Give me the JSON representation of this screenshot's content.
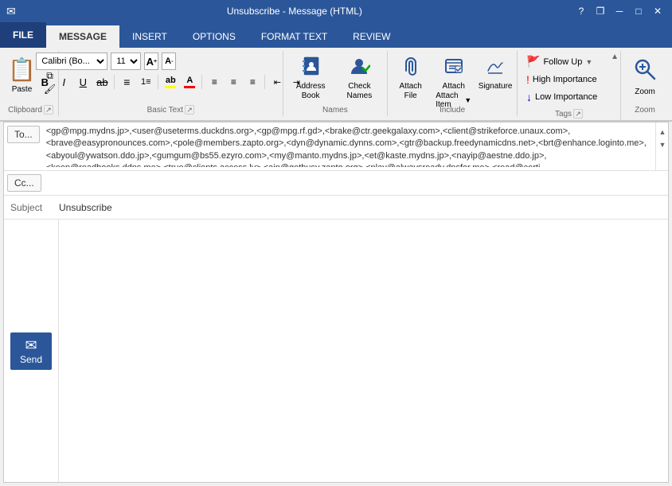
{
  "titleBar": {
    "title": "Unsubscribe - Message (HTML)",
    "helpBtn": "?",
    "restoreBtn": "❐",
    "minimizeBtn": "─",
    "maximizeBtn": "□",
    "closeBtn": "✕"
  },
  "tabs": [
    {
      "id": "file",
      "label": "FILE"
    },
    {
      "id": "message",
      "label": "MESSAGE"
    },
    {
      "id": "insert",
      "label": "INSERT"
    },
    {
      "id": "options",
      "label": "OPTIONS"
    },
    {
      "id": "formattext",
      "label": "FORMAT TEXT"
    },
    {
      "id": "review",
      "label": "REVIEW"
    }
  ],
  "ribbon": {
    "groups": {
      "clipboard": {
        "label": "Clipboard",
        "paste": "Paste",
        "cut": "✂",
        "copy": "⧉",
        "formatPainter": "🖌"
      },
      "basicText": {
        "label": "Basic Text",
        "fontName": "Calibri (Bo...",
        "fontSize": "11",
        "increaseFont": "A",
        "decreaseFont": "A",
        "bold": "B",
        "italic": "I",
        "underline": "U",
        "strikethrough": "ab",
        "highlightColor": "#ffff00",
        "fontColor": "#ff0000"
      },
      "names": {
        "label": "Names",
        "addressBook": "Address\nBook",
        "checkNames": "Check\nNames"
      },
      "include": {
        "label": "Include",
        "attachFile": "Attach\nFile",
        "attachItem": "Attach\nItem",
        "signature": "Signature"
      },
      "tags": {
        "label": "Tags",
        "followUp": "Follow Up",
        "highImportance": "High Importance",
        "lowImportance": "Low Importance",
        "collapseBtn": "▲"
      },
      "zoom": {
        "label": "Zoom",
        "zoomLabel": "Zoom"
      }
    }
  },
  "compose": {
    "toLabel": "To...",
    "toValue": "<gp@mpg.mydns.jp>,<user@useterms.duckdns.org>,<gp@mpg.rf.gd>,<brake@ctr.geekgalaxy.com>,<client@strikeforce.unaux.com>,<brave@easypronounces.com>,<pole@members.zapto.org>,<dyn@dynamic.dynns.com>,<gtr@backup.freedynamicdns.net>,<brt@enhance.loginto.me>,<abyoul@ywatson.ddo.jp>,<gumgum@bs55.ezyro.com>,<my@manto.mydns.jp>,<et@kaste.mydns.jp>,<nayip@aestne.ddo.jp>,<keep@readbooks.ddns.me>,<true@clients.access.ly>,<ain@getbusy.zapto.org>,<play@alwaysready.dnsfor.me>,<read@certi",
    "ccLabel": "Cc...",
    "subjectLabel": "Subject",
    "subjectValue": "Unsubscribe",
    "sendLabel": "Send"
  }
}
